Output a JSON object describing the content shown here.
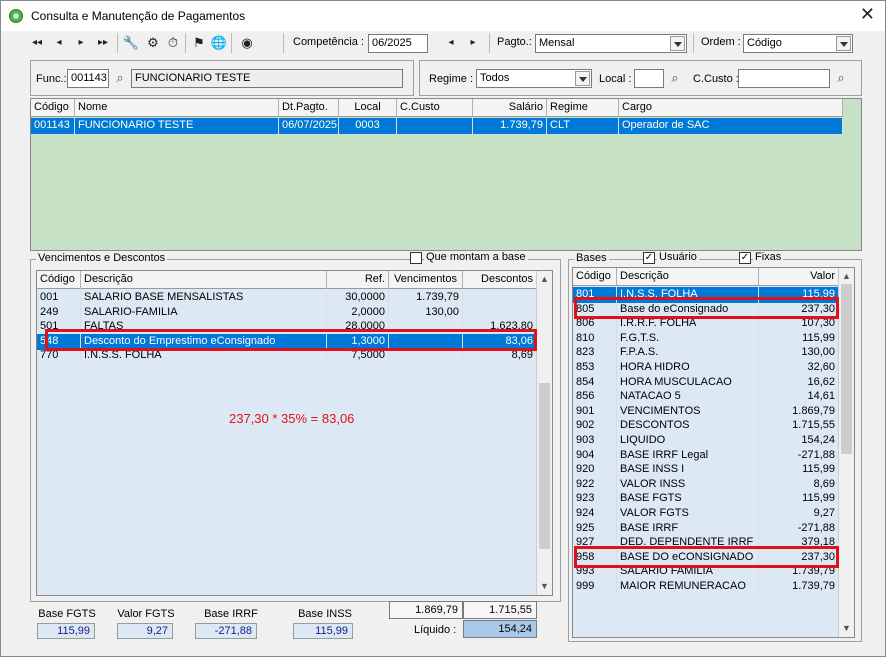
{
  "window": {
    "title": "Consulta e Manutenção de Pagamentos",
    "close": "✕"
  },
  "toolbar": {
    "nav": [
      "◂◂",
      "◂",
      "▸",
      "▸▸"
    ],
    "icons": [
      "🔧",
      "⚙",
      "⏱",
      "⚑",
      "🌐",
      "◉"
    ],
    "competencia_label": "Competência :",
    "competencia_value": "06/2025",
    "comp_nav": [
      "◂",
      "▸"
    ],
    "pagto_label": "Pagto.:",
    "pagto_value": "Mensal",
    "ordem_label": "Ordem :",
    "ordem_value": "Código"
  },
  "filter": {
    "func_label": "Func.:",
    "func_code": "001143",
    "func_name": "FUNCIONARIO TESTE",
    "regime_label": "Regime :",
    "regime_value": "Todos",
    "local_label": "Local :",
    "local_value": "",
    "ccusto_label": "C.Custo :",
    "ccusto_value": ""
  },
  "employees": {
    "headers": [
      "Código",
      "Nome",
      "Dt.Pagto.",
      "Local",
      "C.Custo",
      "Salário",
      "Regime",
      "Cargo"
    ],
    "rows": [
      {
        "codigo": "001143",
        "nome": "FUNCIONARIO TESTE",
        "dtpagto": "06/07/2025",
        "local": "0003",
        "ccusto": "",
        "salario": "1.739,79",
        "regime": "CLT",
        "cargo": "Operador de SAC"
      }
    ]
  },
  "vd": {
    "section_label": "Vencimentos e Descontos",
    "que_montam_label": "Que montam a base",
    "headers": [
      "Código",
      "Descrição",
      "Ref.",
      "Vencimentos",
      "Descontos"
    ],
    "rows": [
      {
        "codigo": "001",
        "descricao": "SALARIO BASE MENSALISTAS",
        "ref": "30,0000",
        "venc": "1.739,79",
        "desc": ""
      },
      {
        "codigo": "249",
        "descricao": "SALARIO-FAMILIA",
        "ref": "2,0000",
        "venc": "130,00",
        "desc": ""
      },
      {
        "codigo": "501",
        "descricao": "FALTAS",
        "ref": "28,0000",
        "venc": "",
        "desc": "1.623,80"
      },
      {
        "codigo": "548",
        "descricao": "Desconto do Emprestimo eConsignado",
        "ref": "1,3000",
        "venc": "",
        "desc": "83,06"
      },
      {
        "codigo": "770",
        "descricao": "I.N.S.S. FOLHA",
        "ref": "7,5000",
        "venc": "",
        "desc": "8,69"
      }
    ],
    "annotation": "237,30 * 35% = 83,06"
  },
  "bases": {
    "section_label": "Bases",
    "usuario_label": "Usuário",
    "fixas_label": "Fixas",
    "check": "✓",
    "headers": [
      "Código",
      "Descrição",
      "Valor"
    ],
    "rows": [
      {
        "codigo": "801",
        "descricao": "I.N.S.S. FOLHA",
        "valor": "115,99"
      },
      {
        "codigo": "805",
        "descricao": "Base do eConsignado",
        "valor": "237,30"
      },
      {
        "codigo": "806",
        "descricao": "I.R.R.F. FOLHA",
        "valor": "107,30"
      },
      {
        "codigo": "810",
        "descricao": "F.G.T.S.",
        "valor": "115,99"
      },
      {
        "codigo": "823",
        "descricao": "F.P.A.S.",
        "valor": "130,00"
      },
      {
        "codigo": "853",
        "descricao": "HORA HIDRO",
        "valor": "32,60"
      },
      {
        "codigo": "854",
        "descricao": "HORA MUSCULACAO",
        "valor": "16,62"
      },
      {
        "codigo": "856",
        "descricao": "NATACAO 5",
        "valor": "14,61"
      },
      {
        "codigo": "901",
        "descricao": "VENCIMENTOS",
        "valor": "1.869,79"
      },
      {
        "codigo": "902",
        "descricao": "DESCONTOS",
        "valor": "1.715,55"
      },
      {
        "codigo": "903",
        "descricao": "LIQUIDO",
        "valor": "154,24"
      },
      {
        "codigo": "904",
        "descricao": "BASE IRRF Legal",
        "valor": "-271,88"
      },
      {
        "codigo": "920",
        "descricao": "BASE INSS I",
        "valor": "115,99"
      },
      {
        "codigo": "922",
        "descricao": "VALOR INSS",
        "valor": "8,69"
      },
      {
        "codigo": "923",
        "descricao": "BASE FGTS",
        "valor": "115,99"
      },
      {
        "codigo": "924",
        "descricao": "VALOR FGTS",
        "valor": "9,27"
      },
      {
        "codigo": "925",
        "descricao": "BASE IRRF",
        "valor": "-271,88"
      },
      {
        "codigo": "927",
        "descricao": "DED. DEPENDENTE IRRF",
        "valor": "379,18"
      },
      {
        "codigo": "958",
        "descricao": "BASE DO eCONSIGNADO",
        "valor": "237,30"
      },
      {
        "codigo": "993",
        "descricao": "SALARIO FAMILIA",
        "valor": "1.739,79"
      },
      {
        "codigo": "999",
        "descricao": "MAIOR REMUNERACAO",
        "valor": "1.739,79"
      }
    ]
  },
  "totals": {
    "base_fgts_label": "Base FGTS",
    "base_fgts": "115,99",
    "valor_fgts_label": "Valor FGTS",
    "valor_fgts": "9,27",
    "base_irrf_label": "Base IRRF",
    "base_irrf": "-271,88",
    "base_inss_label": "Base INSS",
    "base_inss": "115,99",
    "vencimentos": "1.869,79",
    "descontos": "1.715,55",
    "liquido_label": "Líquido :",
    "liquido": "154,24"
  },
  "colors": {
    "selection": "#0078d7",
    "highlight": "#e0111a",
    "grid_bg": "#dce8f3",
    "employee_bg": "#c6e1c6"
  },
  "icon_names": [
    "search-icon",
    "close-icon",
    "chevron-down-icon"
  ]
}
